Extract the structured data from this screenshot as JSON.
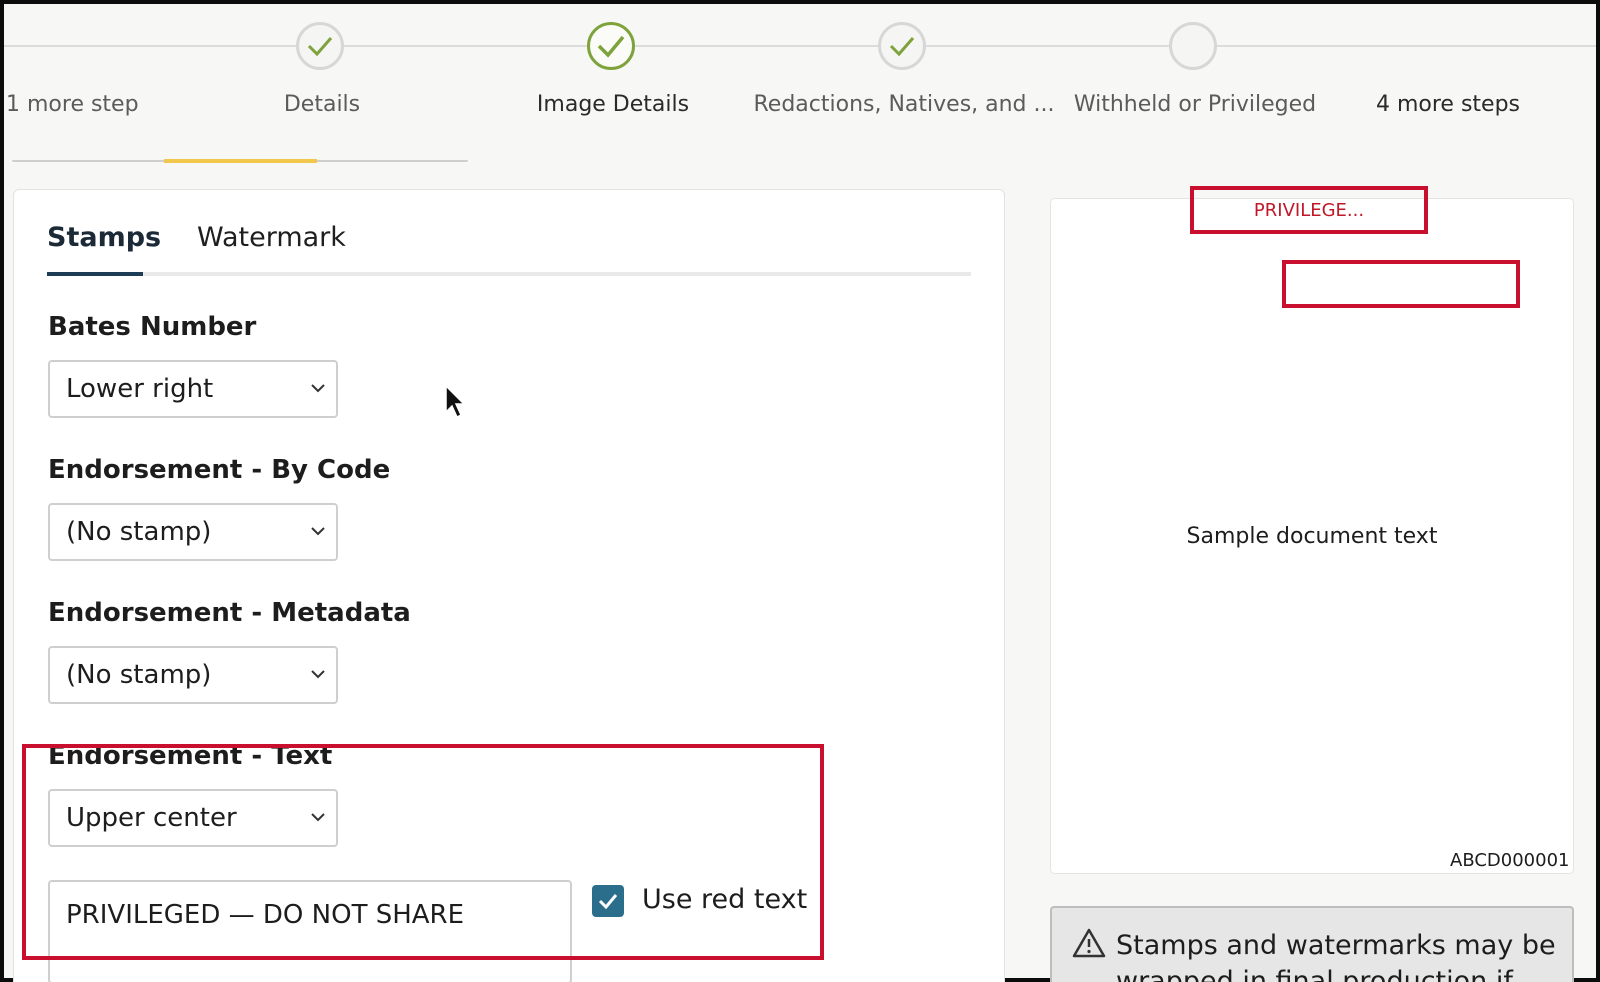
{
  "stepper": {
    "steps": [
      {
        "label": "1 more step",
        "status": "collapsed"
      },
      {
        "label": "Details",
        "status": "complete"
      },
      {
        "label": "Image Details",
        "status": "current"
      },
      {
        "label": "Redactions, Natives, and ...",
        "status": "complete"
      },
      {
        "label": "Withheld or Privileged",
        "status": "pending"
      },
      {
        "label": "4 more steps",
        "status": "collapsed"
      }
    ]
  },
  "tabs": {
    "stamps": "Stamps",
    "watermark": "Watermark"
  },
  "fields": {
    "bates_number": {
      "label": "Bates Number",
      "value": "Lower right"
    },
    "endorsement_by_code": {
      "label": "Endorsement - By Code",
      "value": "(No stamp)"
    },
    "endorsement_metadata": {
      "label": "Endorsement - Metadata",
      "value": "(No stamp)"
    },
    "endorsement_text": {
      "label": "Endorsement - Text",
      "value": "Upper center",
      "text_value": "PRIVILEGED — DO NOT SHARE",
      "use_red_text_label": "Use red text",
      "use_red_text_checked": true
    }
  },
  "preview": {
    "top_stamp": "PRIVILEGE...",
    "sample_text": "Sample document text",
    "bates": "ABCD000001"
  },
  "warning": {
    "text": "Stamps and watermarks may be wrapped in final production if"
  },
  "colors": {
    "accent_green": "#7ea33d",
    "highlight_red": "#c8102e",
    "checkbox_blue": "#2a6e8c",
    "tab_underline": "#1d3d56",
    "step_underline": "#f1c84b"
  }
}
